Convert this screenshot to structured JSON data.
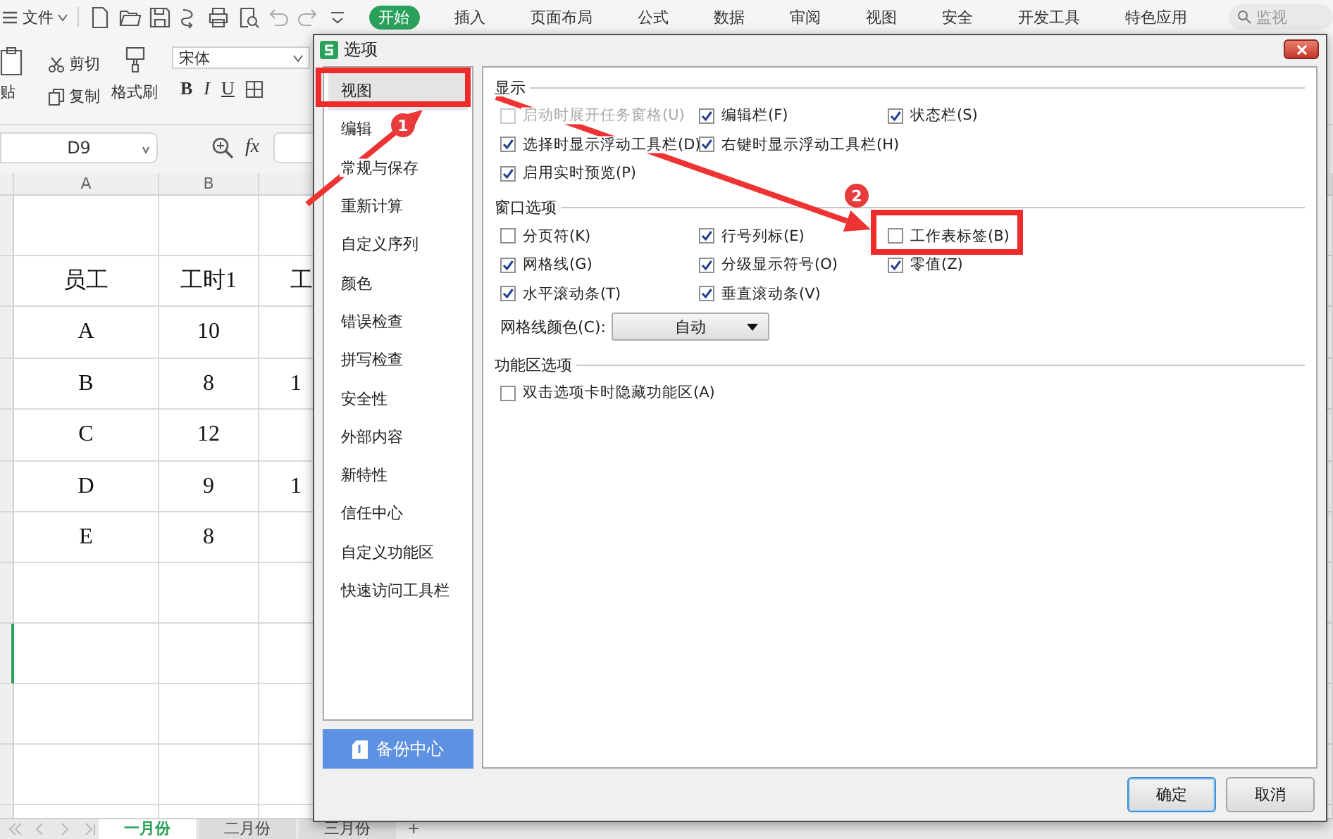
{
  "ribbon": {
    "file_menu": "文件",
    "tabs": [
      {
        "label": "开始",
        "selected": true
      },
      {
        "label": "插入",
        "selected": false
      },
      {
        "label": "页面布局",
        "selected": false
      },
      {
        "label": "公式",
        "selected": false
      },
      {
        "label": "数据",
        "selected": false
      },
      {
        "label": "审阅",
        "selected": false
      },
      {
        "label": "视图",
        "selected": false
      },
      {
        "label": "安全",
        "selected": false
      },
      {
        "label": "开发工具",
        "selected": false
      },
      {
        "label": "特色应用",
        "selected": false
      }
    ],
    "search": {
      "placeholder": "监视"
    },
    "paste": "贴",
    "cut": "剪切",
    "copy": "复制",
    "format_painter": "格式刷",
    "font": "宋体",
    "format_buttons": [
      "B",
      "I",
      "U"
    ]
  },
  "formula_bar": {
    "cell_ref": "D9",
    "fx": "fx"
  },
  "sheet": {
    "columns": [
      "A",
      "B"
    ],
    "rows": [
      [
        "员工",
        "工时1",
        "工"
      ],
      [
        "A",
        "10"
      ],
      [
        "B",
        "8",
        "1"
      ],
      [
        "C",
        "12"
      ],
      [
        "D",
        "9",
        "1"
      ],
      [
        "E",
        "8"
      ]
    ]
  },
  "sheet_tabs": [
    {
      "label": "一月份",
      "selected": true
    },
    {
      "label": "二月份",
      "selected": false
    },
    {
      "label": "三月份",
      "selected": false
    }
  ],
  "add_tab": "+",
  "dialog": {
    "title": "选项",
    "nav": [
      {
        "label": "视图",
        "selected": true
      },
      {
        "label": "编辑",
        "selected": false
      },
      {
        "label": "常规与保存",
        "selected": false
      },
      {
        "label": "重新计算",
        "selected": false
      },
      {
        "label": "自定义序列",
        "selected": false
      },
      {
        "label": "颜色",
        "selected": false
      },
      {
        "label": "错误检查",
        "selected": false
      },
      {
        "label": "拼写检查",
        "selected": false
      },
      {
        "label": "安全性",
        "selected": false
      },
      {
        "label": "外部内容",
        "selected": false
      },
      {
        "label": "新特性",
        "selected": false
      },
      {
        "label": "信任中心",
        "selected": false
      },
      {
        "label": "自定义功能区",
        "selected": false
      },
      {
        "label": "快速访问工具栏",
        "selected": false
      }
    ],
    "backup_button": "备份中心",
    "sections": [
      {
        "title": "显示",
        "rows": [
          [
            {
              "label": "启动时展开任务窗格(U)",
              "checked": false,
              "disabled": true
            },
            {
              "label": "编辑栏(F)",
              "checked": true,
              "disabled": false
            },
            {
              "label": "状态栏(S)",
              "checked": true,
              "disabled": false
            }
          ],
          [
            {
              "label": "选择时显示浮动工具栏(D)",
              "checked": true,
              "disabled": false
            },
            {
              "label": "右键时显示浮动工具栏(H)",
              "checked": true,
              "disabled": false
            }
          ],
          [
            {
              "label": "启用实时预览(P)",
              "checked": true,
              "disabled": false
            }
          ]
        ]
      },
      {
        "title": "窗口选项",
        "rows": [
          [
            {
              "label": "分页符(K)",
              "checked": false,
              "disabled": false
            },
            {
              "label": "行号列标(E)",
              "checked": true,
              "disabled": false
            },
            {
              "label": "工作表标签(B)",
              "checked": false,
              "disabled": false
            }
          ],
          [
            {
              "label": "网格线(G)",
              "checked": true,
              "disabled": false
            },
            {
              "label": "分级显示符号(O)",
              "checked": true,
              "disabled": false
            },
            {
              "label": "零值(Z)",
              "checked": true,
              "disabled": false
            }
          ],
          [
            {
              "label": "水平滚动条(T)",
              "checked": true,
              "disabled": false
            },
            {
              "label": "垂直滚动条(V)",
              "checked": true,
              "disabled": false
            }
          ]
        ],
        "gridline_color": {
          "label": "网格线颜色(C):",
          "value": "自动"
        }
      },
      {
        "title": "功能区选项",
        "rows": [
          [
            {
              "label": "双击选项卡时隐藏功能区(A)",
              "checked": false,
              "disabled": false
            }
          ]
        ]
      }
    ],
    "buttons": [
      {
        "label": "确定",
        "kind": "default"
      },
      {
        "label": "取消",
        "kind": "normal"
      }
    ]
  },
  "annotations": [
    {
      "number": "1"
    },
    {
      "number": "2"
    }
  ]
}
